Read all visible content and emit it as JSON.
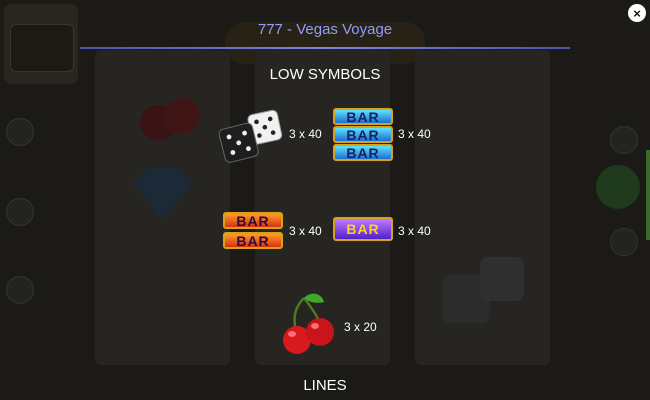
{
  "title": "777 - Vegas Voyage",
  "close_icon": "×",
  "sections": {
    "low_symbols": "LOW SYMBOLS",
    "lines": "LINES"
  },
  "paytable": {
    "dice": "3 x 40",
    "blue_bar_stack": "3 x 40",
    "orange_bar_stack": "3 x 40",
    "purple_bar": "3 x 40",
    "cherries": "3 x 20"
  },
  "symbol_text": {
    "bar": "BAR"
  },
  "colors": {
    "title": "#8f9cff",
    "overlay_bg": "#151515",
    "bar_blue": "#1c6fd0",
    "bar_orange": "#d63212",
    "bar_purple": "#5120c8",
    "bar_border": "#d7a11b",
    "cherry": "#d8191e"
  }
}
